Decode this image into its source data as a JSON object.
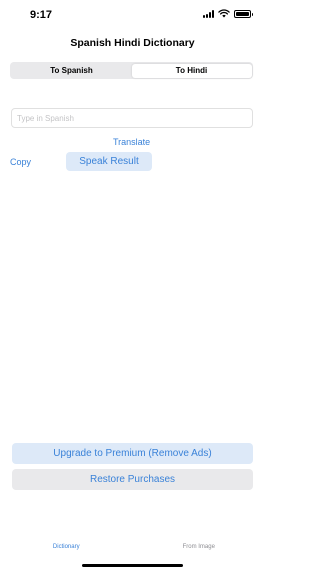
{
  "status_bar": {
    "time": "9:17"
  },
  "nav": {
    "title": "Spanish Hindi Dictionary"
  },
  "segmented": {
    "options": [
      {
        "label": "To Spanish",
        "selected": false
      },
      {
        "label": "To Hindi",
        "selected": true
      }
    ]
  },
  "input": {
    "placeholder": "Type in Spanish",
    "value": ""
  },
  "actions": {
    "translate_label": "Translate",
    "copy_label": "Copy",
    "speak_label": "Speak Result"
  },
  "purchase": {
    "premium_label": "Upgrade to Premium (Remove Ads)",
    "restore_label": "Restore Purchases"
  },
  "tabs": [
    {
      "label": "Dictionary",
      "active": true
    },
    {
      "label": "From Image",
      "active": false
    }
  ],
  "colors": {
    "accent": "#3a82d8",
    "accent_bg": "#dde9f8",
    "segment_bg": "#e9e9eb"
  }
}
